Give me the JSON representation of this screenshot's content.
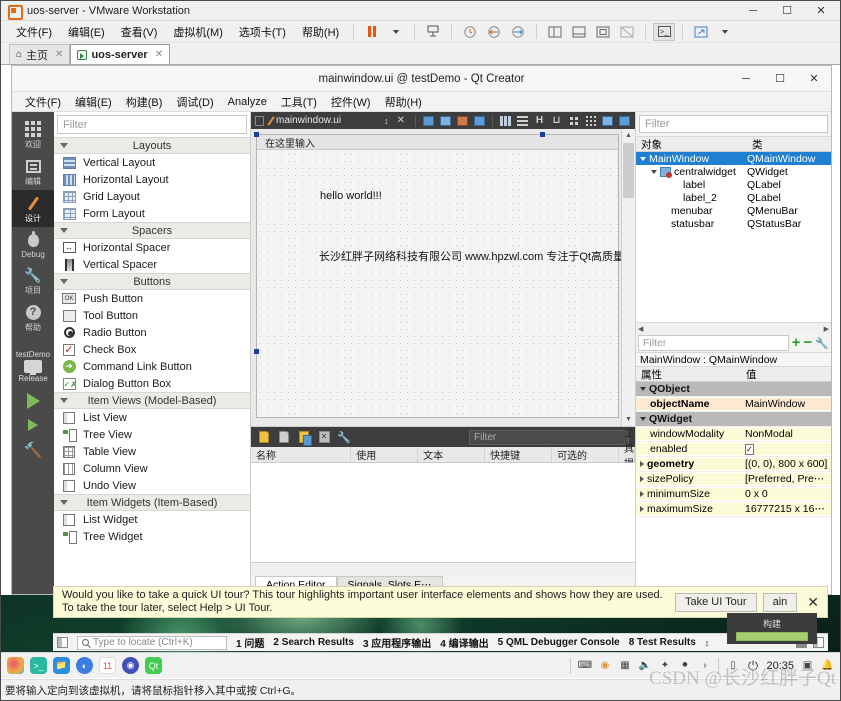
{
  "vmware": {
    "title": "uos-server - VMware Workstation",
    "menus": [
      "文件(F)",
      "编辑(E)",
      "查看(V)",
      "虚拟机(M)",
      "选项卡(T)",
      "帮助(H)"
    ],
    "window_buttons": {
      "minimize": "─",
      "maximize": "☐",
      "close": "✕"
    },
    "tabs": [
      {
        "label": "主页",
        "close": "✕",
        "active": false
      },
      {
        "label": "uos-server",
        "close": "✕",
        "active": true
      }
    ],
    "statusbar": "要将输入定向到该虚拟机，请将鼠标指针移入其中或按 Ctrl+G。"
  },
  "qtcreator": {
    "title": "mainwindow.ui @ testDemo - Qt Creator",
    "window_buttons": {
      "minimize": "─",
      "maximize": "☐",
      "close": "✕"
    },
    "menus": [
      "文件(F)",
      "编辑(E)",
      "构建(B)",
      "调试(D)",
      "Analyze",
      "工具(T)",
      "控件(W)",
      "帮助(H)"
    ],
    "modes": [
      {
        "label": "欢迎",
        "icon": "welcome-grid-icon",
        "active": false
      },
      {
        "label": "编辑",
        "icon": "edit-icon",
        "active": false
      },
      {
        "label": "设计",
        "icon": "design-pencil-icon",
        "active": true
      },
      {
        "label": "Debug",
        "icon": "debug-bug-icon",
        "active": false
      },
      {
        "label": "项目",
        "icon": "projects-wrench-icon",
        "active": false
      },
      {
        "label": "帮助",
        "icon": "help-question-icon",
        "active": false
      }
    ],
    "kit": {
      "project": "testDemo",
      "build_config": "Release"
    },
    "form_toolbar": {
      "filename": "mainwindow.ui"
    },
    "widget_box": {
      "filter_placeholder": "Filter",
      "groups": [
        {
          "name": "Layouts",
          "items": [
            {
              "label": "Vertical Layout",
              "icon": "vertical-layout-icon"
            },
            {
              "label": "Horizontal Layout",
              "icon": "horizontal-layout-icon"
            },
            {
              "label": "Grid Layout",
              "icon": "grid-layout-icon"
            },
            {
              "label": "Form Layout",
              "icon": "form-layout-icon"
            }
          ]
        },
        {
          "name": "Spacers",
          "items": [
            {
              "label": "Horizontal Spacer",
              "icon": "horizontal-spacer-icon"
            },
            {
              "label": "Vertical Spacer",
              "icon": "vertical-spacer-icon"
            }
          ]
        },
        {
          "name": "Buttons",
          "items": [
            {
              "label": "Push Button",
              "icon": "push-button-icon"
            },
            {
              "label": "Tool Button",
              "icon": "tool-button-icon"
            },
            {
              "label": "Radio Button",
              "icon": "radio-button-icon"
            },
            {
              "label": "Check Box",
              "icon": "check-box-icon"
            },
            {
              "label": "Command Link Button",
              "icon": "command-link-button-icon"
            },
            {
              "label": "Dialog Button Box",
              "icon": "dialog-button-box-icon"
            }
          ]
        },
        {
          "name": "Item Views (Model-Based)",
          "items": [
            {
              "label": "List View",
              "icon": "list-view-icon"
            },
            {
              "label": "Tree View",
              "icon": "tree-view-icon"
            },
            {
              "label": "Table View",
              "icon": "table-view-icon"
            },
            {
              "label": "Column View",
              "icon": "column-view-icon"
            },
            {
              "label": "Undo View",
              "icon": "undo-view-icon"
            }
          ]
        },
        {
          "name": "Item Widgets (Item-Based)",
          "items": [
            {
              "label": "List Widget",
              "icon": "list-widget-icon"
            },
            {
              "label": "Tree Widget",
              "icon": "tree-widget-icon"
            }
          ]
        }
      ]
    },
    "form_canvas": {
      "menubar_placeholder": "在这里输入",
      "label_hello": "hello world!!!",
      "label_company": "长沙红胖子网络科技有限公司 www.hpzwl.com 专注于Qt高质量定制开发"
    },
    "action_editor": {
      "filter_placeholder": "Filter",
      "columns": [
        "名称",
        "使用",
        "文本",
        "快捷键",
        "可选的",
        "工具提示"
      ],
      "rows": [],
      "tabs": [
        {
          "label": "Action Editor",
          "active": true
        },
        {
          "label": "Signals_Slots E⋯",
          "active": false
        }
      ]
    },
    "object_inspector": {
      "filter_placeholder": "Filter",
      "columns": [
        "对象",
        "类"
      ],
      "rows": [
        {
          "name": "MainWindow",
          "class": "QMainWindow",
          "indent": 0,
          "selected": true,
          "expander": "down",
          "icon": ""
        },
        {
          "name": "centralwidget",
          "class": "QWidget",
          "indent": 1,
          "selected": false,
          "expander": "down",
          "icon": "central-widget-icon"
        },
        {
          "name": "label",
          "class": "QLabel",
          "indent": 2,
          "selected": false,
          "expander": "",
          "icon": ""
        },
        {
          "name": "label_2",
          "class": "QLabel",
          "indent": 2,
          "selected": false,
          "expander": "",
          "icon": ""
        },
        {
          "name": "menubar",
          "class": "QMenuBar",
          "indent": 1,
          "selected": false,
          "expander": "",
          "icon": ""
        },
        {
          "name": "statusbar",
          "class": "QStatusBar",
          "indent": 1,
          "selected": false,
          "expander": "",
          "icon": ""
        }
      ]
    },
    "property_editor": {
      "filter_placeholder": "Filter",
      "add_label": "+",
      "remove_label": "−",
      "config_label": "configure-icon",
      "target": "MainWindow : QMainWindow",
      "columns": [
        "属性",
        "值"
      ],
      "rows": [
        {
          "name": "QObject",
          "value": "",
          "kind": "group",
          "expander": "down"
        },
        {
          "name": "objectName",
          "value": "MainWindow",
          "kind": "hl",
          "expander": ""
        },
        {
          "name": "QWidget",
          "value": "",
          "kind": "group",
          "expander": "down"
        },
        {
          "name": "windowModality",
          "value": "NonModal",
          "kind": "yl",
          "expander": ""
        },
        {
          "name": "enabled",
          "value": "✓",
          "kind": "yl-check",
          "expander": ""
        },
        {
          "name": "geometry",
          "value": "[(0, 0), 800 x 600]",
          "kind": "yl-bold",
          "expander": "right"
        },
        {
          "name": "sizePolicy",
          "value": "[Preferred, Pre⋯",
          "kind": "yl",
          "expander": "right"
        },
        {
          "name": "minimumSize",
          "value": "0 x 0",
          "kind": "yl",
          "expander": "right"
        },
        {
          "name": "maximumSize",
          "value": "16777215 x 16⋯",
          "kind": "yl",
          "expander": "right"
        }
      ]
    },
    "tour_banner": {
      "text": "Would you like to take a quick UI tour? This tour highlights important user interface elements and shows how they are used. To take the tour later, select Help > UI Tour.",
      "take_tour_label": "Take UI Tour",
      "do_not_show_label": "ain",
      "close_label": "✕"
    },
    "build_tooltip": {
      "label": "构建",
      "progress_percent": 70
    },
    "locator": {
      "placeholder": "Type to locate (Ctrl+K)",
      "panes": [
        {
          "num": "1",
          "label": "问题"
        },
        {
          "num": "2",
          "label": "Search Results"
        },
        {
          "num": "3",
          "label": "应用程序输出"
        },
        {
          "num": "4",
          "label": "编译输出"
        },
        {
          "num": "5",
          "label": "QML Debugger Console"
        },
        {
          "num": "8",
          "label": "Test Results"
        }
      ]
    }
  },
  "guest_desktop": {
    "dock_icons": [
      "launcher-icon",
      "terminal-icon",
      "files-icon",
      "browser-icon",
      "calendar-icon",
      "appstore-icon",
      "qtcreator-icon"
    ],
    "tray_icons": [
      "keyboard-icon",
      "update-icon",
      "input-method-icon",
      "volume-icon",
      "brightness-icon",
      "user-icon",
      "expand-icon"
    ],
    "clock": "20:35"
  },
  "watermark": "CSDN @长沙红胖子Qt"
}
